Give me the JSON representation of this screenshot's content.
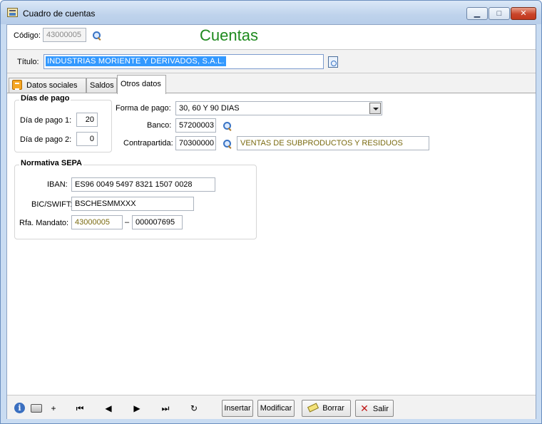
{
  "window": {
    "title": "Cuadro de cuentas",
    "controls": {
      "minimize": "▁",
      "maximize": "□",
      "close": "✕"
    }
  },
  "header": {
    "codigo_label": "Código:",
    "codigo_value": "43000005",
    "big_title": "Cuentas",
    "titulo_label": "Título:",
    "titulo_value": "INDUSTRIAS MORIENTE Y DERIVADOS, S.A.L."
  },
  "tabs": [
    {
      "label": "Datos sociales",
      "icon": "document-list-icon"
    },
    {
      "label": "Saldos"
    },
    {
      "label": "Otros datos",
      "active": true
    }
  ],
  "dias_pago": {
    "title": "Días de pago",
    "dia1_label": "Día de pago 1:",
    "dia1_value": "20",
    "dia2_label": "Día de pago 2:",
    "dia2_value": "0"
  },
  "pago": {
    "forma_label": "Forma de pago:",
    "forma_value": "30, 60 Y 90 DIAS",
    "banco_label": "Banco:",
    "banco_value": "57200003",
    "contrapartida_label": "Contrapartida:",
    "contrapartida_value": "70300000",
    "contrapartida_desc": "VENTAS DE SUBPRODUCTOS Y RESIDUOS"
  },
  "sepa": {
    "title": "Normativa SEPA",
    "iban_label": "IBAN:",
    "iban_value": "ES96 0049 5497 8321 1507 0028",
    "bic_label": "BIC/SWIFT:",
    "bic_value": "BSCHESMMXXX",
    "mandato_label": "Rfa. Mandato:",
    "mandato_value1": "43000005",
    "mandato_sep": "–",
    "mandato_value2": "000007695"
  },
  "toolbar": {
    "add": "+",
    "first": "⏮",
    "prev": "◀",
    "next": "▶",
    "last": "⏭",
    "refresh": "↻",
    "insertar": "Insertar",
    "modificar": "Modificar",
    "borrar": "Borrar",
    "salir": "Salir"
  },
  "colors": {
    "title_green": "#1f8a1f",
    "selection_blue": "#3399ff",
    "olive_text": "#7a6a10"
  }
}
